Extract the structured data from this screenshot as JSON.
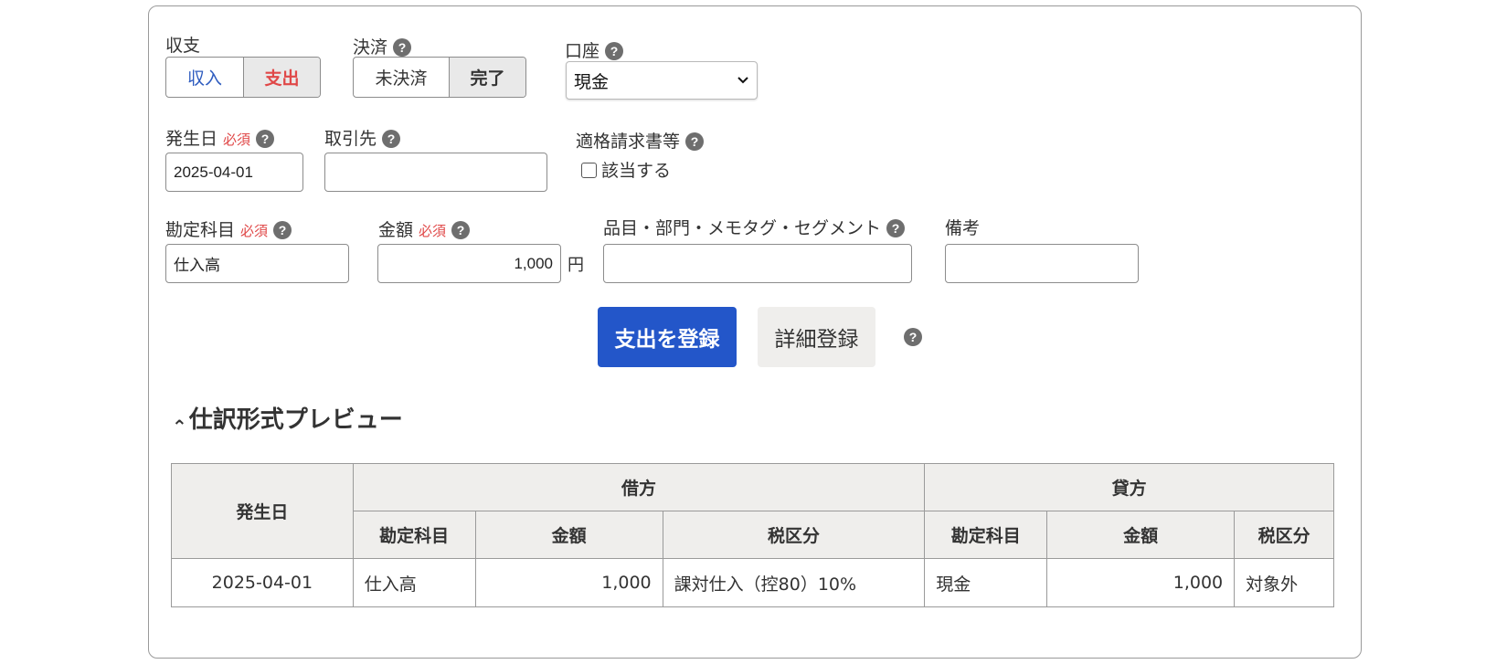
{
  "form": {
    "income_expense": {
      "label": "収支",
      "options": [
        "収入",
        "支出"
      ],
      "selected": "支出"
    },
    "settlement": {
      "label": "決済",
      "options": [
        "未決済",
        "完了"
      ],
      "selected": "完了"
    },
    "account": {
      "label": "口座",
      "value": "現金"
    },
    "date": {
      "label": "発生日",
      "required": "必須",
      "value": "2025-04-01"
    },
    "partner": {
      "label": "取引先",
      "value": ""
    },
    "invoice": {
      "label": "適格請求書等",
      "checkbox_label": "該当する",
      "checked": false
    },
    "account_item": {
      "label": "勘定科目",
      "required": "必須",
      "value": "仕入高"
    },
    "amount": {
      "label": "金額",
      "required": "必須",
      "value": "1,000",
      "unit": "円"
    },
    "tags": {
      "label": "品目・部門・メモタグ・セグメント",
      "value": ""
    },
    "remarks": {
      "label": "備考",
      "value": ""
    },
    "help_glyph": "?"
  },
  "actions": {
    "submit_label": "支出を登録",
    "detail_label": "詳細登録"
  },
  "preview": {
    "title": "仕訳形式プレビュー",
    "toggle_glyph": "⌃",
    "headers": {
      "date": "発生日",
      "debit": "借方",
      "credit": "貸方",
      "account": "勘定科目",
      "amount": "金額",
      "tax": "税区分"
    },
    "rows": [
      {
        "date": "2025-04-01",
        "debit_account": "仕入高",
        "debit_amount": "1,000",
        "debit_tax": "課対仕入（控80）10%",
        "credit_account": "現金",
        "credit_amount": "1,000",
        "credit_tax": "対象外"
      }
    ]
  },
  "colors": {
    "primary": "#2356c9",
    "income_text": "#2d5bbf",
    "expense_text": "#e04848",
    "required_text": "#e04848",
    "header_bg": "#efeeec"
  }
}
